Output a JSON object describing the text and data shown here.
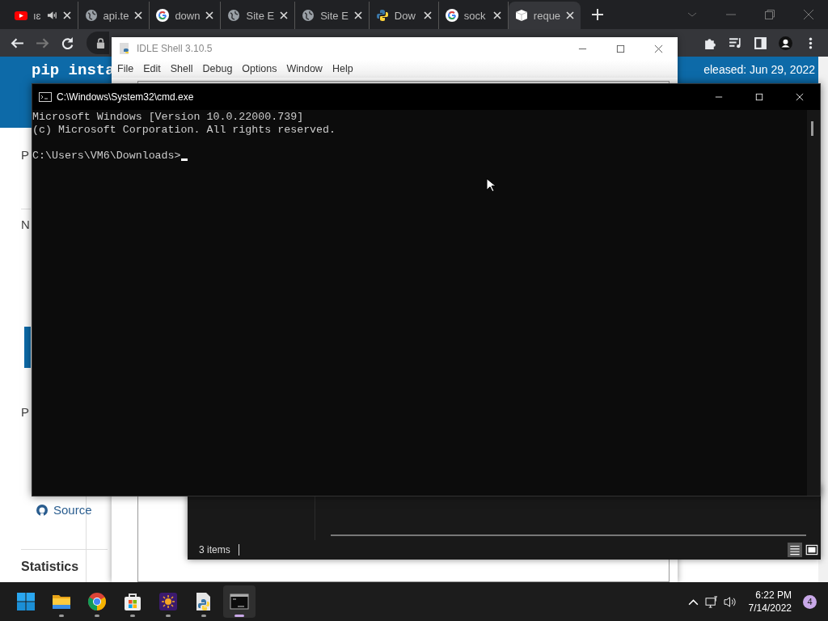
{
  "browser": {
    "tabs": [
      {
        "label": "ıɛ",
        "kind": "youtube",
        "audio": true,
        "selected": false
      },
      {
        "label": "api.te",
        "kind": "globe",
        "audio": false,
        "selected": false
      },
      {
        "label": "down",
        "kind": "google",
        "audio": false,
        "selected": false
      },
      {
        "label": "Site E",
        "kind": "globe",
        "audio": false,
        "selected": false
      },
      {
        "label": "Site E",
        "kind": "globe",
        "audio": false,
        "selected": false
      },
      {
        "label": "Dow",
        "kind": "python",
        "audio": false,
        "selected": false
      },
      {
        "label": "sock",
        "kind": "google",
        "audio": false,
        "selected": false
      },
      {
        "label": "reque",
        "kind": "cube",
        "audio": false,
        "selected": true
      }
    ],
    "page": {
      "header_code": "pip insta",
      "release": "eleased: Jun 29, 2022",
      "sidebar": [
        {
          "kind": "text",
          "label": "P"
        },
        {
          "kind": "text",
          "label": "N"
        },
        {
          "kind": "text",
          "label": "P"
        },
        {
          "kind": "link",
          "label": "Source"
        },
        {
          "kind": "heading",
          "label": "Statistics"
        }
      ]
    }
  },
  "idle": {
    "title": "IDLE Shell 3.10.5",
    "menu": [
      "File",
      "Edit",
      "Shell",
      "Debug",
      "Options",
      "Window",
      "Help"
    ]
  },
  "explorer": {
    "status": "3 items"
  },
  "cmd": {
    "title": "C:\\Windows\\System32\\cmd.exe",
    "output": [
      "Microsoft Windows [Version 10.0.22000.739]",
      "(c) Microsoft Corporation. All rights reserved."
    ],
    "prompt": "C:\\Users\\VM6\\Downloads>"
  },
  "taskbar": {
    "apps": [
      {
        "kind": "start",
        "active": false,
        "running": false
      },
      {
        "kind": "folder",
        "active": false,
        "running": true
      },
      {
        "kind": "chrome",
        "active": false,
        "running": true
      },
      {
        "kind": "store",
        "active": false,
        "running": true
      },
      {
        "kind": "sun",
        "active": false,
        "running": true
      },
      {
        "kind": "python",
        "active": false,
        "running": true
      },
      {
        "kind": "terminal",
        "active": true,
        "running": true
      }
    ],
    "time": "6:22 PM",
    "date": "7/14/2022",
    "notifications": "4"
  }
}
